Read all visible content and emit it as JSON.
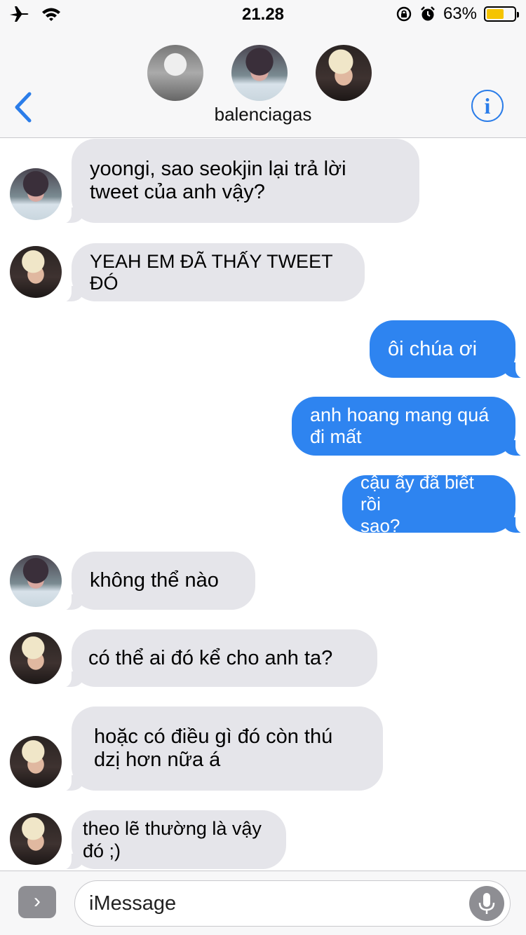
{
  "status_bar": {
    "time": "21.28",
    "battery_percent_label": "63%",
    "battery_level": 0.63,
    "icons": [
      "airplane-icon",
      "wifi-icon",
      "orientation-lock-icon",
      "alarm-icon",
      "battery-icon"
    ],
    "battery_color": "#f5c400"
  },
  "header": {
    "group_name": "balenciagas",
    "back_icon": "chevron-left-icon",
    "info_icon": "info-icon",
    "info_glyph": "i",
    "accent": "#2b7de9"
  },
  "messages": [
    {
      "sender": "incoming",
      "avatar": "a",
      "lines": [
        "yoongi, sao seokjin lại trả lời",
        "tweet của anh vậy?"
      ]
    },
    {
      "sender": "incoming",
      "avatar": "b",
      "lines": [
        "YEAH EM ĐÃ THẤY TWEET",
        "ĐÓ"
      ]
    },
    {
      "sender": "outgoing",
      "lines": [
        "ôi chúa ơi"
      ]
    },
    {
      "sender": "outgoing",
      "lines": [
        "anh hoang mang quá",
        "đi mất"
      ]
    },
    {
      "sender": "outgoing",
      "lines": [
        "cậu ấy đã biết rồi",
        "sao?"
      ]
    },
    {
      "sender": "incoming",
      "avatar": "a",
      "lines": [
        "không thể nào"
      ]
    },
    {
      "sender": "incoming",
      "avatar": "b",
      "lines": [
        "có thể ai đó kể cho anh ta?"
      ]
    },
    {
      "sender": "incoming",
      "avatar": "b",
      "lines": [
        "hoặc có điều gì đó còn thú",
        "dzị hơn nữa á"
      ]
    },
    {
      "sender": "incoming",
      "avatar": "b",
      "lines": [
        "theo lẽ thường là vậy",
        "đó ;)"
      ]
    }
  ],
  "colors": {
    "incoming_bubble": "#e5e5ea",
    "outgoing_bubble": "#2e84f0"
  },
  "input": {
    "placeholder": "iMessage",
    "apps_icon": "chevron-right-icon",
    "apps_glyph": "›",
    "mic_icon": "microphone-icon"
  }
}
